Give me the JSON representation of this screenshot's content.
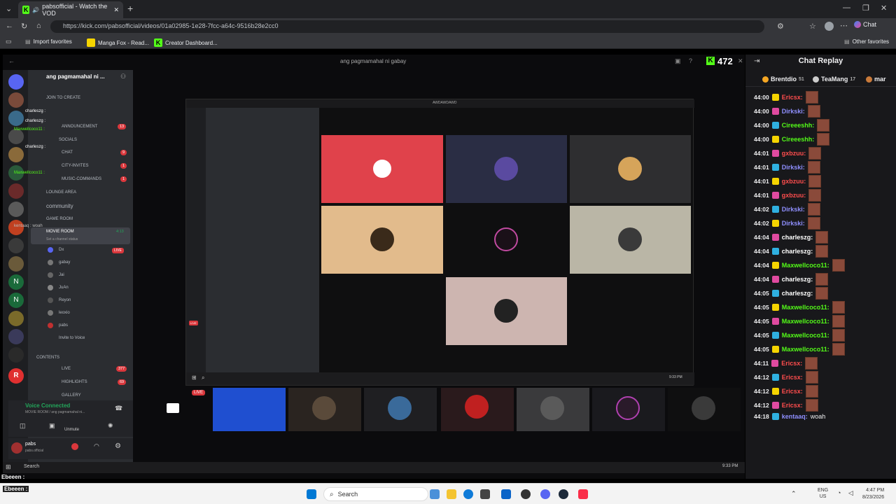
{
  "browser": {
    "tab_title": "pabsofficial - Watch the VOD",
    "url": "https://kick.com/pabsofficial/videos/01a02985-1e28-7fcc-a64c-9516b28e2cc0",
    "chat_button": "Chat",
    "bookmarks": [
      "Import favorites",
      "Manga Fox - Read...",
      "Creator Dashboard..."
    ],
    "other_favorites": "Other favorites"
  },
  "video": {
    "window_title": "ang pagmamahal ni gabay",
    "viewer_count": "472",
    "server_name": "ang pagmamahal ni ...",
    "join_to_create": "JOIN TO CREATE",
    "channels": [
      "ANNOUNCEMENT",
      "SOCIALS",
      "CHAT",
      "CITY-INVITES",
      "MUSIC-COMMANDS",
      "LOUNGE AREA",
      "community",
      "GAME ROOM",
      "MOVIE ROOM"
    ],
    "channel_counts": [
      "13",
      "",
      "9",
      "1",
      "1",
      "",
      "",
      "",
      "4:13"
    ],
    "movie_room_status": "Set a channel status",
    "members": [
      "Dx",
      "gabay",
      "Jai",
      "JuAn",
      "Reyon",
      "leoxio",
      "pabs"
    ],
    "invite_to_voice": "Invite to Voice",
    "contents": "CONTENTS",
    "live": "LIVE",
    "live_count": "377",
    "highlights": "HIGHLIGHTS",
    "highlights_count": "69",
    "gallery": "GALLERY",
    "voice_connected": "Voice Connected",
    "voice_sub": "MOVIE ROOM / ang pagmamahal ni...",
    "unmute": "Unmute",
    "user_name": "pabs",
    "user_tag": "pabs.official",
    "overlay_names": [
      "charleszg :",
      "charleszg :",
      "charleszg :",
      "Maxwellcoco11 :",
      "Maxwellcoco11 :",
      "kentaaq : woah"
    ],
    "inner_title": "AWDAWDAWD",
    "live_badge": "LIVE",
    "inner_search": "Search",
    "inner_time": "9:33 PM"
  },
  "chat": {
    "title": "Chat Replay",
    "gifters": [
      {
        "name": "Brentdio",
        "count": "51"
      },
      {
        "name": "TeaMang",
        "count": "17"
      },
      {
        "name": "mar",
        "count": ""
      }
    ],
    "messages": [
      {
        "time": "44:00",
        "user": "Ericsx:",
        "color": "#ff4d4d",
        "text": ""
      },
      {
        "time": "44:00",
        "user": "Dirkski:",
        "color": "#8f8fff",
        "text": ""
      },
      {
        "time": "44:00",
        "user": "Cireeeshh:",
        "color": "#53fc18",
        "text": ""
      },
      {
        "time": "44:00",
        "user": "Cireeeshh:",
        "color": "#53fc18",
        "text": ""
      },
      {
        "time": "44:01",
        "user": "gxbzuu:",
        "color": "#ff4d4d",
        "text": ""
      },
      {
        "time": "44:01",
        "user": "Dirkski:",
        "color": "#8f8fff",
        "text": ""
      },
      {
        "time": "44:01",
        "user": "gxbzuu:",
        "color": "#ff4d4d",
        "text": ""
      },
      {
        "time": "44:01",
        "user": "gxbzuu:",
        "color": "#ff4d4d",
        "text": ""
      },
      {
        "time": "44:02",
        "user": "Dirkski:",
        "color": "#8f8fff",
        "text": ""
      },
      {
        "time": "44:02",
        "user": "Dirkski:",
        "color": "#8f8fff",
        "text": ""
      },
      {
        "time": "44:04",
        "user": "charleszg:",
        "color": "#ffffff",
        "text": ""
      },
      {
        "time": "44:04",
        "user": "charleszg:",
        "color": "#ffffff",
        "text": ""
      },
      {
        "time": "44:04",
        "user": "Maxwellcoco11:",
        "color": "#53fc18",
        "text": ""
      },
      {
        "time": "44:04",
        "user": "charleszg:",
        "color": "#ffffff",
        "text": ""
      },
      {
        "time": "44:05",
        "user": "charleszg:",
        "color": "#ffffff",
        "text": ""
      },
      {
        "time": "44:05",
        "user": "Maxwellcoco11:",
        "color": "#53fc18",
        "text": ""
      },
      {
        "time": "44:05",
        "user": "Maxwellcoco11:",
        "color": "#53fc18",
        "text": ""
      },
      {
        "time": "44:05",
        "user": "Maxwellcoco11:",
        "color": "#53fc18",
        "text": ""
      },
      {
        "time": "44:05",
        "user": "Maxwellcoco11:",
        "color": "#53fc18",
        "text": ""
      },
      {
        "time": "44:11",
        "user": "Ericsx:",
        "color": "#ff4d4d",
        "text": ""
      },
      {
        "time": "44:12",
        "user": "Ericsx:",
        "color": "#ff4d4d",
        "text": ""
      },
      {
        "time": "44:12",
        "user": "Ericsx:",
        "color": "#ff4d4d",
        "text": ""
      },
      {
        "time": "44:12",
        "user": "Ericsx:",
        "color": "#ff4d4d",
        "text": ""
      },
      {
        "time": "44:18",
        "user": "kentaaq:",
        "color": "#8f8fff",
        "text": "woah"
      }
    ]
  },
  "taskbar": {
    "search": "Search",
    "lang": "ENG",
    "region": "US",
    "time": "4:47 PM",
    "date": "8/23/2026"
  },
  "overlay_bottom": [
    "Ebeeen :",
    "Ebeeen :"
  ],
  "colors": {
    "kick_green": "#53fc18",
    "chat_bg": "#18181b",
    "discord_bg": "#1e1f22"
  }
}
